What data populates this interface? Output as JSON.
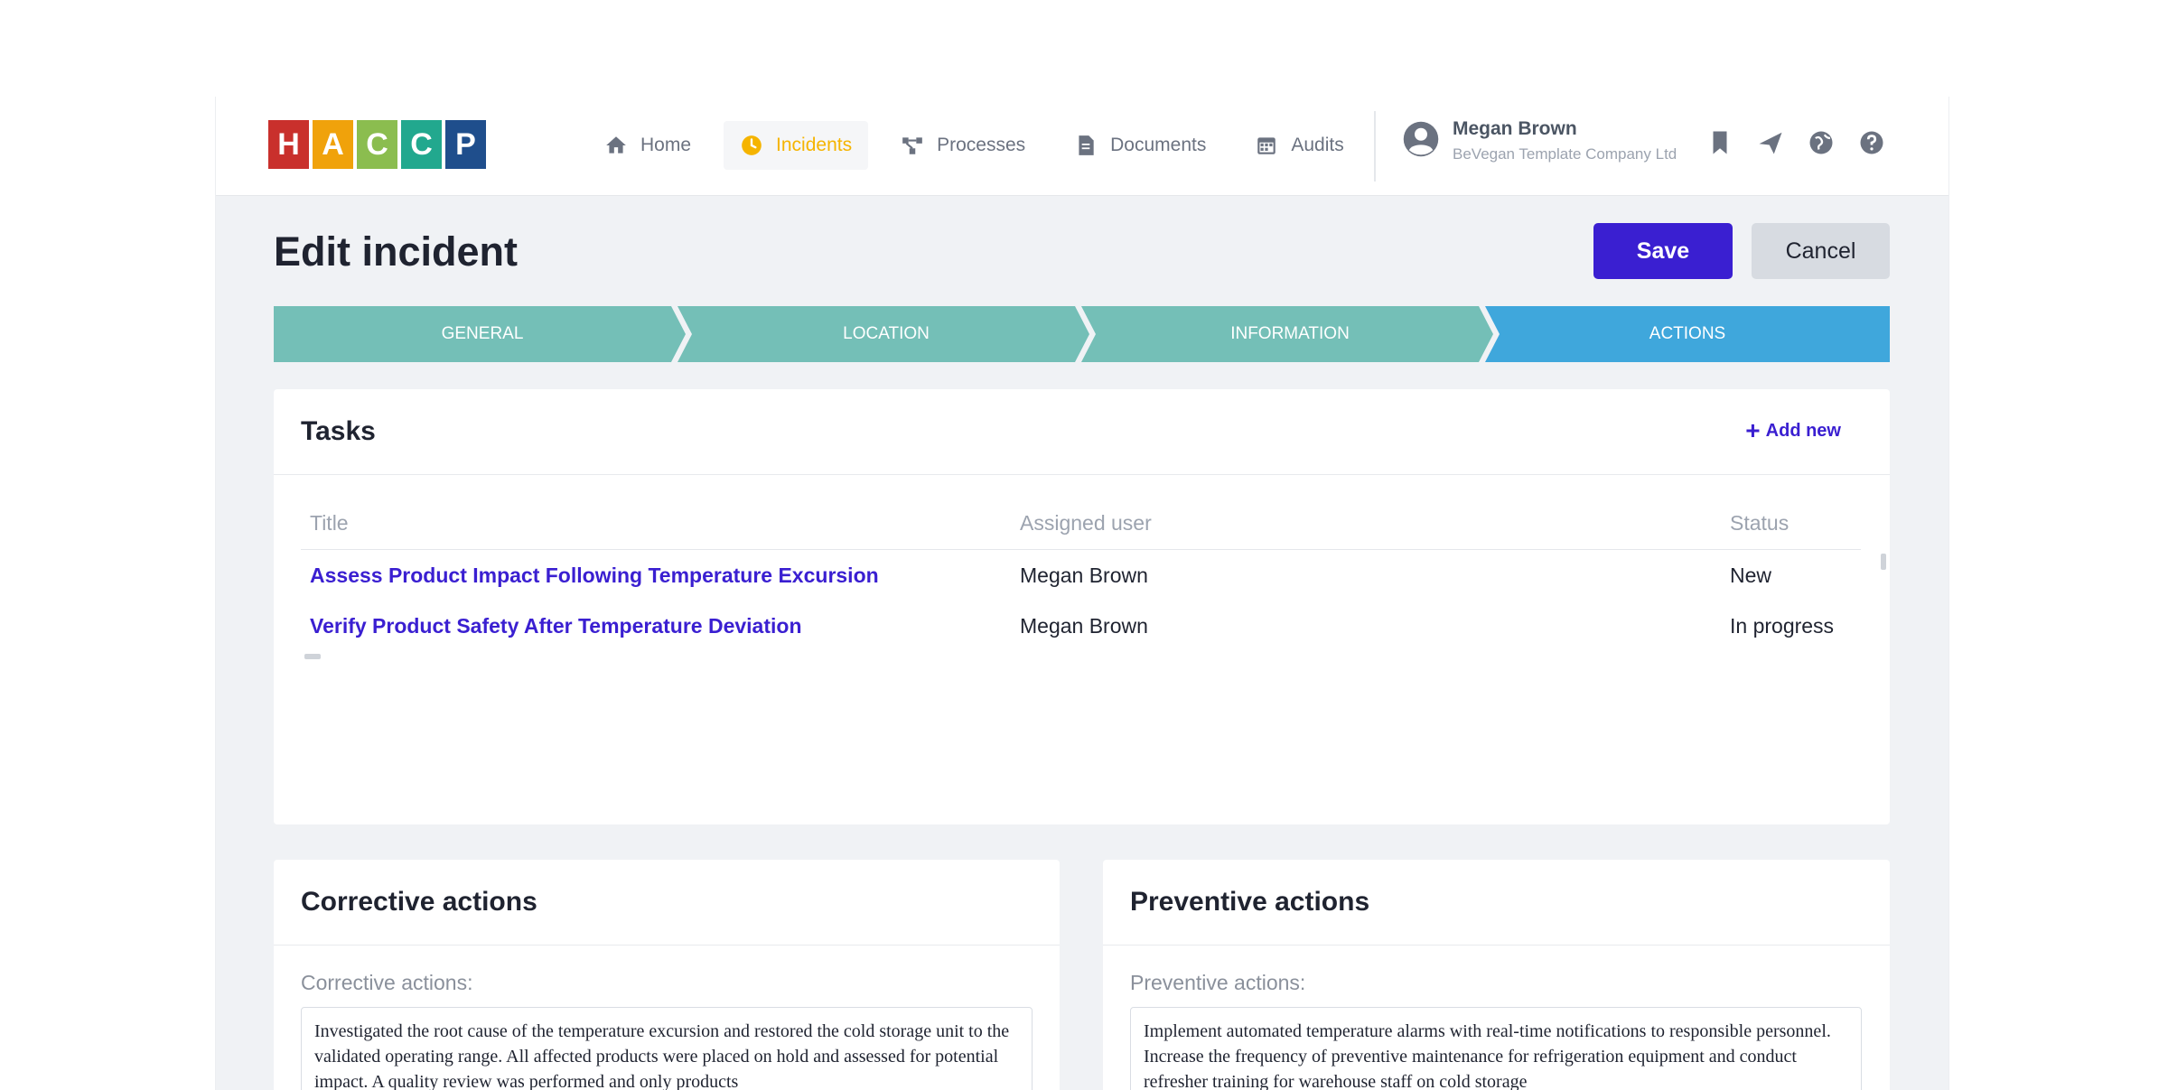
{
  "brand": {
    "letters": [
      {
        "char": "H",
        "color": "#c9302c"
      },
      {
        "char": "A",
        "color": "#f0a20b"
      },
      {
        "char": "C",
        "color": "#8bbd4f"
      },
      {
        "char": "C",
        "color": "#22a88e"
      },
      {
        "char": "P",
        "color": "#1f4e8c"
      }
    ]
  },
  "nav": {
    "items": [
      {
        "label": "Home",
        "icon": "home-icon",
        "active": false
      },
      {
        "label": "Incidents",
        "icon": "clock-icon",
        "active": true
      },
      {
        "label": "Processes",
        "icon": "flow-icon",
        "active": false
      },
      {
        "label": "Documents",
        "icon": "document-icon",
        "active": false
      },
      {
        "label": "Audits",
        "icon": "calendar-icon",
        "active": false
      }
    ]
  },
  "user": {
    "name": "Megan Brown",
    "company": "BeVegan Template Company Ltd"
  },
  "page": {
    "title": "Edit incident",
    "save_label": "Save",
    "cancel_label": "Cancel"
  },
  "stepper": {
    "steps": [
      {
        "label": "GENERAL",
        "active": false
      },
      {
        "label": "LOCATION",
        "active": false
      },
      {
        "label": "INFORMATION",
        "active": false
      },
      {
        "label": "ACTIONS",
        "active": true
      }
    ],
    "colors": {
      "done": "#74bfb7",
      "active": "#3fa7dc"
    }
  },
  "tasks": {
    "title": "Tasks",
    "add_new_label": "Add new",
    "columns": [
      "Title",
      "Assigned user",
      "Status"
    ],
    "rows": [
      {
        "title": "Assess Product Impact Following Temperature Excursion",
        "user": "Megan Brown",
        "status": "New"
      },
      {
        "title": "Verify Product Safety After Temperature Deviation",
        "user": "Megan Brown",
        "status": "In progress"
      }
    ]
  },
  "corrective": {
    "title": "Corrective actions",
    "label": "Corrective actions:",
    "text": "Investigated the root cause of the temperature excursion and restored the cold storage unit to the validated operating range. All affected products were placed on hold and assessed for potential impact. A quality review was performed and only products"
  },
  "preventive": {
    "title": "Preventive actions",
    "label": "Preventive actions:",
    "text": "Implement automated temperature alarms with real-time notifications to responsible personnel. Increase the frequency of preventive maintenance for refrigeration equipment and conduct refresher training for warehouse staff on cold storage"
  }
}
